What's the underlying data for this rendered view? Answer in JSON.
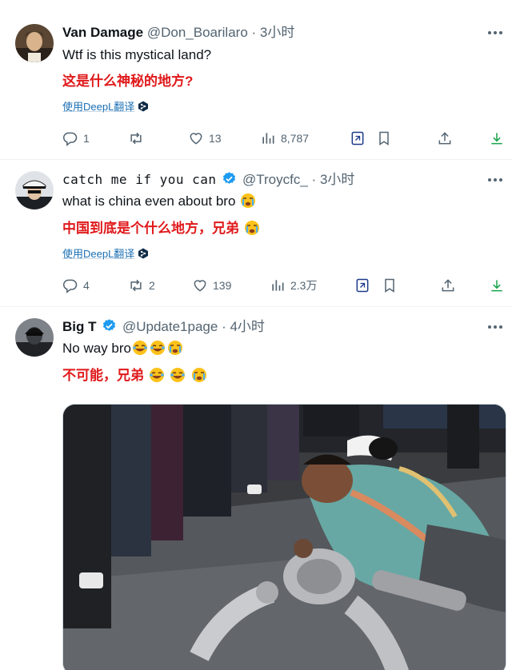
{
  "tweets": [
    {
      "display_name": "Van Damage",
      "handle": "@Don_Boarilaro",
      "time": "3小时",
      "text": "Wtf is this mystical land?",
      "translation": "这是什么神秘的地方?",
      "translate_link": "使用DeepL翻译",
      "replies": "1",
      "likes": "13",
      "views": "8,787"
    },
    {
      "display_name": "catch me if you can",
      "handle": "@Troycfc_",
      "time": "3小时",
      "text": "what is china even about bro",
      "translation": "中国到底是个什么地方，兄弟",
      "translate_link": "使用DeepL翻译",
      "replies": "4",
      "retweets": "2",
      "likes": "139",
      "views": "2.3万"
    },
    {
      "display_name": "Big T",
      "handle": "@Update1page",
      "time": "4小时",
      "text": "No way bro",
      "translation": "不可能，兄弟"
    }
  ],
  "separator": "·",
  "colors": {
    "accent": "#1d9bf0",
    "translation": "#e0191b",
    "muted": "#536471",
    "deepl": "#1b6fb3"
  }
}
